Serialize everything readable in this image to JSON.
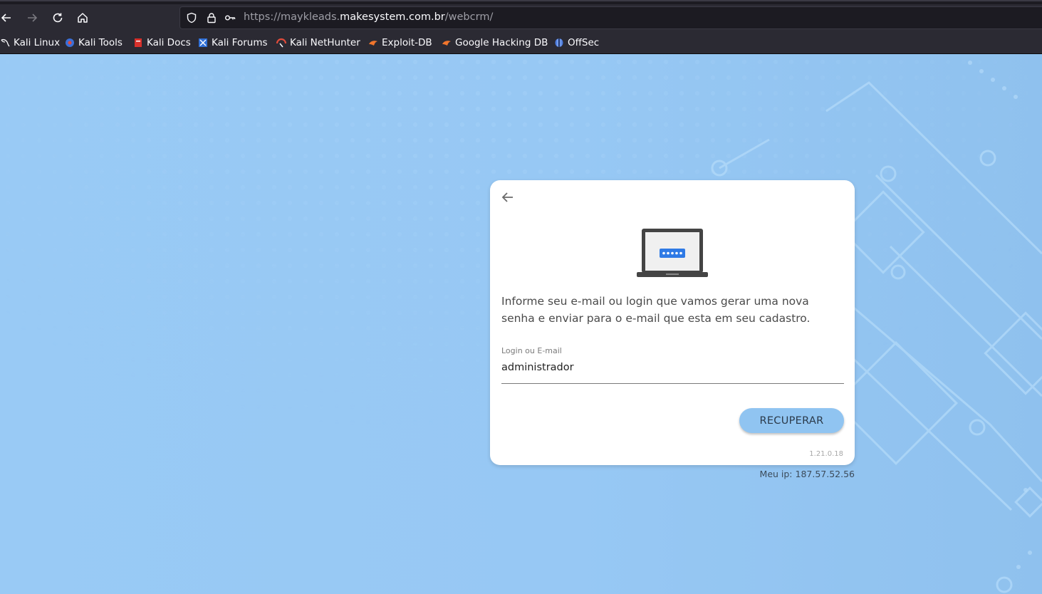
{
  "browser": {
    "url_prefix": "https://maykleads.",
    "url_host": "makesystem.com.br",
    "url_path": "/webcrm/",
    "bookmarks": [
      {
        "label": "Kali Linux",
        "icon": "kali-dragon-icon"
      },
      {
        "label": "Kali Tools",
        "icon": "kali-tools-icon"
      },
      {
        "label": "Kali Docs",
        "icon": "kali-docs-icon"
      },
      {
        "label": "Kali Forums",
        "icon": "kali-forums-icon"
      },
      {
        "label": "Kali NetHunter",
        "icon": "kali-nethunter-icon"
      },
      {
        "label": "Exploit-DB",
        "icon": "exploit-db-icon"
      },
      {
        "label": "Google Hacking DB",
        "icon": "ghdb-icon"
      },
      {
        "label": "OffSec",
        "icon": "offsec-icon"
      }
    ]
  },
  "card": {
    "description": "Informe seu e-mail ou login que vamos gerar uma nova senha e enviar para o e-mail que esta em seu cadastro.",
    "field_label": "Login ou E-mail",
    "field_value": "administrador",
    "button_label": "RECUPERAR",
    "version": "1.21.0.18"
  },
  "footer": {
    "ip_text": "Meu ip: 187.57.52.56"
  },
  "colors": {
    "background": "#94c7f3",
    "button": "#90c4f1",
    "card": "#ffffff"
  }
}
